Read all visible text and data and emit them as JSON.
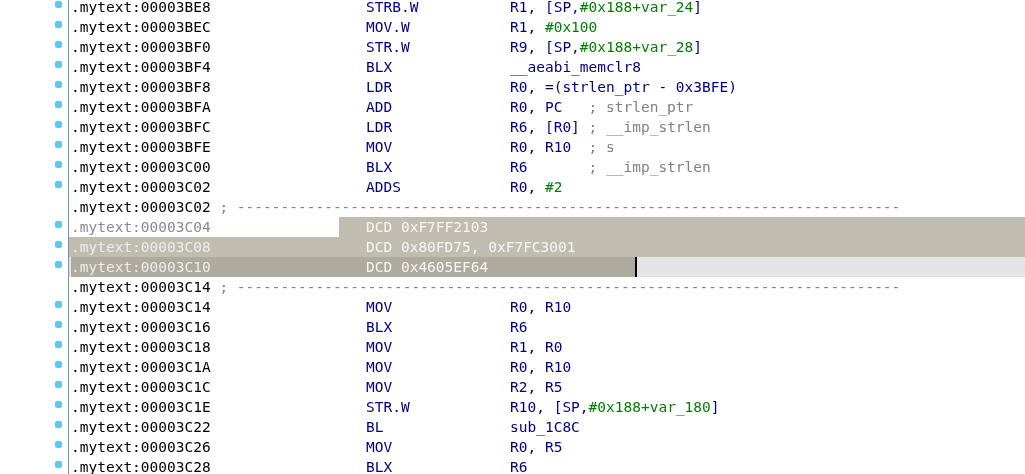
{
  "listing": {
    "rows": [
      {
        "kind": "insn",
        "address": ".mytext:00003BE8",
        "mnemonic": "STRB.W",
        "operand": [
          {
            "text": "R1, [SP,",
            "kind": "op"
          },
          {
            "text": "#0x188+var_24",
            "kind": "num"
          },
          {
            "text": "]",
            "kind": "op"
          }
        ],
        "marker": true,
        "selected": false,
        "current": false
      },
      {
        "kind": "insn",
        "address": ".mytext:00003BEC",
        "mnemonic": "MOV.W",
        "operand": [
          {
            "text": "R1, ",
            "kind": "op"
          },
          {
            "text": "#0x100",
            "kind": "num"
          }
        ],
        "marker": true,
        "selected": false,
        "current": false
      },
      {
        "kind": "insn",
        "address": ".mytext:00003BF0",
        "mnemonic": "STR.W",
        "operand": [
          {
            "text": "R9, [SP,",
            "kind": "op"
          },
          {
            "text": "#0x188+var_28",
            "kind": "num"
          },
          {
            "text": "]",
            "kind": "op"
          }
        ],
        "marker": true,
        "selected": false,
        "current": false
      },
      {
        "kind": "insn",
        "address": ".mytext:00003BF4",
        "mnemonic": "BLX",
        "operand": [
          {
            "text": "__aeabi_memclr8",
            "kind": "op"
          }
        ],
        "marker": true,
        "selected": false,
        "current": false
      },
      {
        "kind": "insn",
        "address": ".mytext:00003BF8",
        "mnemonic": "LDR",
        "operand": [
          {
            "text": "R0, =(strlen_ptr - 0x3BFE)",
            "kind": "op"
          }
        ],
        "marker": true,
        "selected": false,
        "current": false
      },
      {
        "kind": "insn",
        "address": ".mytext:00003BFA",
        "mnemonic": "ADD",
        "operand": [
          {
            "text": "R0, PC",
            "kind": "op"
          }
        ],
        "comment": "; strlen_ptr",
        "marker": true,
        "selected": false,
        "current": false
      },
      {
        "kind": "insn",
        "address": ".mytext:00003BFC",
        "mnemonic": "LDR",
        "operand": [
          {
            "text": "R6, [R0]",
            "kind": "op"
          }
        ],
        "comment": "; __imp_strlen",
        "marker": true,
        "selected": false,
        "current": false
      },
      {
        "kind": "insn",
        "address": ".mytext:00003BFE",
        "mnemonic": "MOV",
        "operand": [
          {
            "text": "R0, R10",
            "kind": "op"
          }
        ],
        "comment": "; s",
        "marker": true,
        "selected": false,
        "current": false
      },
      {
        "kind": "insn",
        "address": ".mytext:00003C00",
        "mnemonic": "BLX",
        "operand": [
          {
            "text": "R6",
            "kind": "op"
          }
        ],
        "comment": "; __imp_strlen",
        "marker": true,
        "selected": false,
        "current": false
      },
      {
        "kind": "insn",
        "address": ".mytext:00003C02",
        "mnemonic": "ADDS",
        "operand": [
          {
            "text": "R0, ",
            "kind": "op"
          },
          {
            "text": "#2",
            "kind": "num"
          }
        ],
        "marker": true,
        "selected": false,
        "current": false
      },
      {
        "kind": "separator",
        "address": ".mytext:00003C02",
        "comment": "; ----------------------------------------------------------------------------",
        "marker": false,
        "selected": false,
        "current": false
      },
      {
        "kind": "data",
        "address": ".mytext:00003C04",
        "mnemonic": "DCD",
        "operand": [
          {
            "text": "0xF7FF2103",
            "kind": "op"
          }
        ],
        "marker": true,
        "selected": true,
        "current": false
      },
      {
        "kind": "data",
        "address": ".mytext:00003C08",
        "mnemonic": "DCD",
        "operand": [
          {
            "text": "0x80FD75, 0xF7FC3001",
            "kind": "op"
          }
        ],
        "marker": true,
        "selected": true,
        "current": false
      },
      {
        "kind": "data",
        "address": ".mytext:00003C10",
        "mnemonic": "DCD",
        "operand": [
          {
            "text": "0x4605EF64",
            "kind": "op"
          }
        ],
        "marker": true,
        "selected": true,
        "current": true
      },
      {
        "kind": "separator",
        "address": ".mytext:00003C14",
        "comment": "; ----------------------------------------------------------------------------",
        "marker": false,
        "selected": false,
        "current": false
      },
      {
        "kind": "insn",
        "address": ".mytext:00003C14",
        "mnemonic": "MOV",
        "operand": [
          {
            "text": "R0, R10",
            "kind": "op"
          }
        ],
        "marker": true,
        "selected": false,
        "current": false
      },
      {
        "kind": "insn",
        "address": ".mytext:00003C16",
        "mnemonic": "BLX",
        "operand": [
          {
            "text": "R6",
            "kind": "op"
          }
        ],
        "marker": true,
        "selected": false,
        "current": false
      },
      {
        "kind": "insn",
        "address": ".mytext:00003C18",
        "mnemonic": "MOV",
        "operand": [
          {
            "text": "R1, R0",
            "kind": "op"
          }
        ],
        "marker": true,
        "selected": false,
        "current": false
      },
      {
        "kind": "insn",
        "address": ".mytext:00003C1A",
        "mnemonic": "MOV",
        "operand": [
          {
            "text": "R0, R10",
            "kind": "op"
          }
        ],
        "marker": true,
        "selected": false,
        "current": false
      },
      {
        "kind": "insn",
        "address": ".mytext:00003C1C",
        "mnemonic": "MOV",
        "operand": [
          {
            "text": "R2, R5",
            "kind": "op"
          }
        ],
        "marker": true,
        "selected": false,
        "current": false
      },
      {
        "kind": "insn",
        "address": ".mytext:00003C1E",
        "mnemonic": "STR.W",
        "operand": [
          {
            "text": "R10, [SP,",
            "kind": "op"
          },
          {
            "text": "#0x188+var_180",
            "kind": "num"
          },
          {
            "text": "]",
            "kind": "op"
          }
        ],
        "marker": true,
        "selected": false,
        "current": false
      },
      {
        "kind": "insn",
        "address": ".mytext:00003C22",
        "mnemonic": "BL",
        "operand": [
          {
            "text": "sub_1C8C",
            "kind": "op"
          }
        ],
        "marker": true,
        "selected": false,
        "current": false
      },
      {
        "kind": "insn",
        "address": ".mytext:00003C26",
        "mnemonic": "MOV",
        "operand": [
          {
            "text": "R0, R5",
            "kind": "op"
          }
        ],
        "marker": true,
        "selected": false,
        "current": false
      },
      {
        "kind": "insn",
        "address": ".mytext:00003C28",
        "mnemonic": "BLX",
        "operand": [
          {
            "text": "R6",
            "kind": "op"
          }
        ],
        "marker": true,
        "selected": false,
        "current": false
      }
    ]
  }
}
